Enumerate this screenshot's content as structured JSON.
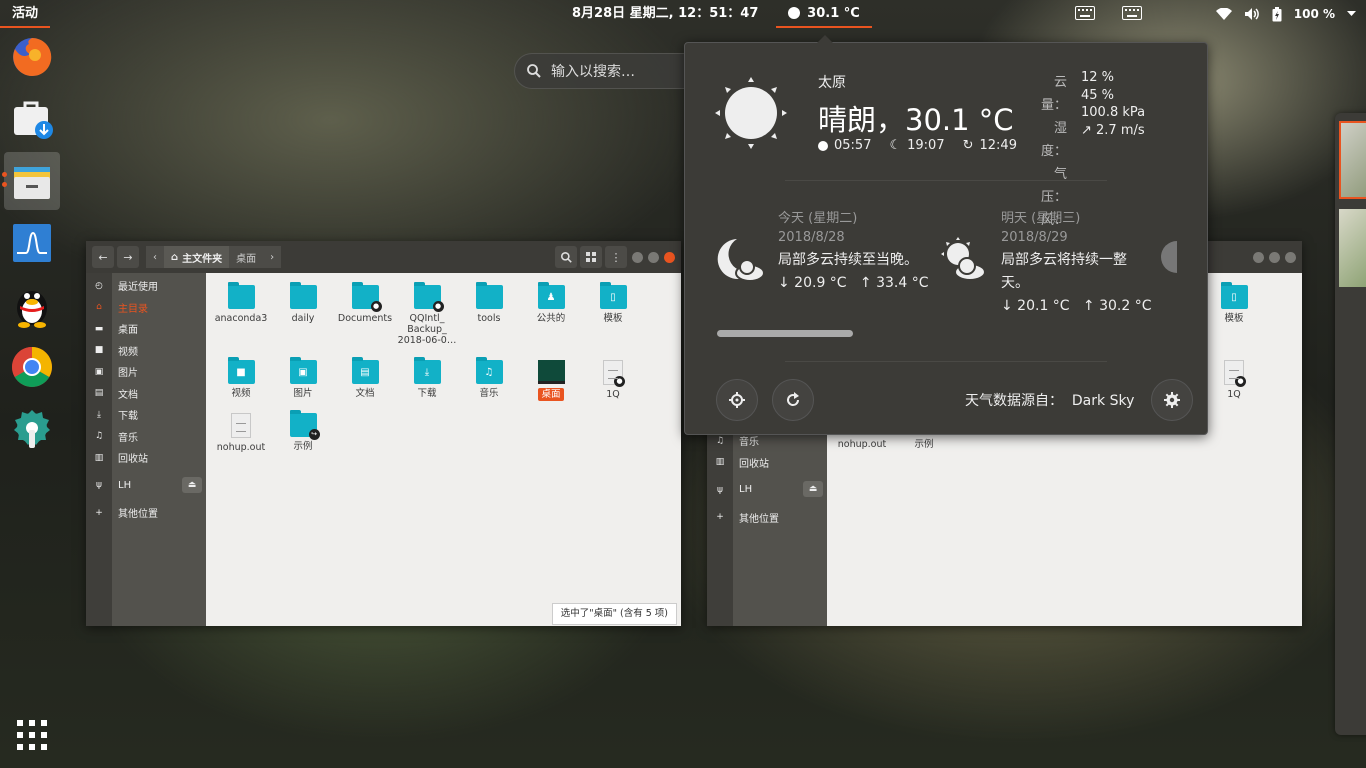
{
  "topbar": {
    "activities": "活动",
    "clock": "8月28日 星期二, 12：51：47",
    "weather_temp": "30.1 °C",
    "battery": "100 %"
  },
  "search": {
    "placeholder": "输入以搜索…"
  },
  "dock": {
    "items": [
      "firefox",
      "software-center",
      "files",
      "system-monitor",
      "qq",
      "chrome",
      "settings",
      "show-apps"
    ]
  },
  "files_left": {
    "path": {
      "home": "主文件夹",
      "current": "桌面"
    },
    "sidebar": [
      "最近使用",
      "主目录",
      "桌面",
      "视频",
      "图片",
      "文档",
      "下载",
      "音乐",
      "回收站",
      "LH",
      "其他位置"
    ],
    "row1": [
      "anaconda3",
      "daily",
      "Documents",
      "QQIntl_ Backup_ 2018-06-0…",
      "tools",
      "公共的",
      "模板"
    ],
    "row2": [
      "视频",
      "图片",
      "文档",
      "下载",
      "音乐",
      "桌面",
      "1Q"
    ],
    "row3": [
      "nohup.out",
      "示例"
    ],
    "status": "选中了\"桌面\" (含有 5 项)"
  },
  "files_right": {
    "sidebar": [
      "音乐",
      "回收站",
      "LH",
      "其他位置"
    ],
    "files": [
      "模板",
      "1Q",
      "nohup.out",
      "示例"
    ]
  },
  "weather": {
    "city": "太原",
    "summary": "晴朗，30.1 °C",
    "sunrise": "05:57",
    "sunset": "19:07",
    "updated": "12:49",
    "labels": [
      "云量：",
      "湿度：",
      "气压：",
      "风："
    ],
    "values": [
      "12 %",
      "45 %",
      "100.8 kPa",
      "↗ 2.7 m/s"
    ],
    "forecast": [
      {
        "day": "今天 (星期二)",
        "date": "2018/8/28",
        "desc": "局部多云持续至当晚。",
        "temps": "↓ 20.9 °C   ↑ 33.4 °C"
      },
      {
        "day": "明天 (星期三)",
        "date": "2018/8/29",
        "desc": "局部多云将持续一整天。",
        "temps": "↓ 20.1 °C   ↑ 30.2 °C"
      }
    ],
    "source": "天气数据源自：  Dark Sky"
  }
}
